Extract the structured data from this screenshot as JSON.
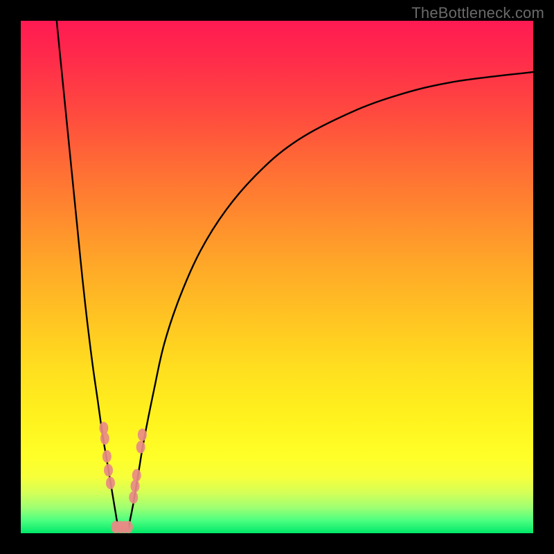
{
  "watermark": "TheBottleneck.com",
  "chart_data": {
    "type": "line",
    "title": "",
    "xlabel": "",
    "ylabel": "",
    "xlim": [
      0,
      100
    ],
    "ylim": [
      0,
      100
    ],
    "grid": false,
    "legend": false,
    "note": "Curves encode bottleneck percentage; valley near bottom ≈ 0% (green), upper regions ≈ 100% (red). Values are visually estimated from the gradient scale.",
    "series": [
      {
        "name": "left-curve",
        "x": [
          7,
          8,
          9,
          10,
          11,
          12,
          13,
          14,
          15,
          16,
          17,
          18,
          19
        ],
        "y": [
          100,
          90,
          80,
          70,
          60,
          50,
          41,
          33,
          26,
          19,
          13,
          7,
          1
        ]
      },
      {
        "name": "right-curve",
        "x": [
          21,
          22,
          23,
          24,
          26,
          28,
          31,
          35,
          40,
          46,
          53,
          62,
          72,
          84,
          100
        ],
        "y": [
          1,
          6,
          12,
          18,
          28,
          37,
          46,
          55,
          63,
          70,
          76,
          81,
          85,
          88,
          90
        ]
      }
    ],
    "points": {
      "name": "highlight-dots",
      "note": "Pink/salmon circular markers clustered near the valley bottom on both curves.",
      "color": "#e88a85",
      "xy": [
        [
          16.2,
          20.5
        ],
        [
          16.4,
          18.5
        ],
        [
          16.8,
          15.0
        ],
        [
          17.1,
          12.3
        ],
        [
          17.5,
          9.8
        ],
        [
          18.5,
          1.2
        ],
        [
          19.4,
          1.2
        ],
        [
          20.2,
          1.2
        ],
        [
          21.0,
          1.2
        ],
        [
          22.0,
          7.0
        ],
        [
          22.3,
          9.2
        ],
        [
          22.6,
          11.3
        ],
        [
          23.4,
          16.8
        ],
        [
          23.7,
          19.2
        ]
      ]
    },
    "gradient_scale": {
      "type": "vertical",
      "note": "Color corresponds to y-value: green at bottom (~0%) through yellow/orange to red at top (~100%)."
    }
  }
}
